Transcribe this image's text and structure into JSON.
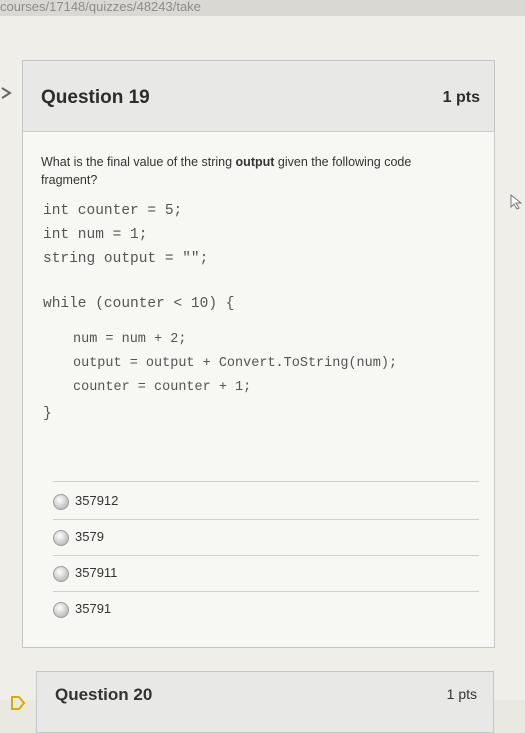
{
  "browser": {
    "url": "courses/17148/quizzes/48243/take"
  },
  "question": {
    "title": "Question 19",
    "points": "1 pts",
    "prompt_before": "What is the final value of the string ",
    "prompt_bold": "output",
    "prompt_after": " given the following code fragment?",
    "code": {
      "line1": "int counter = 5;",
      "line2": "int num = 1;",
      "line3": "string output = \"\";",
      "line4": "while (counter < 10) {",
      "line5": "num = num + 2;",
      "line6": "output = output + Convert.ToString(num);",
      "line7": "counter = counter + 1;",
      "line8": "}"
    },
    "answers": [
      "357912",
      "3579",
      "357911",
      "35791"
    ]
  },
  "next_question": {
    "title": "Question 20",
    "points": "1 pts"
  },
  "icons": [
    "flag-icon",
    "radio-icon",
    "cursor-icon"
  ]
}
